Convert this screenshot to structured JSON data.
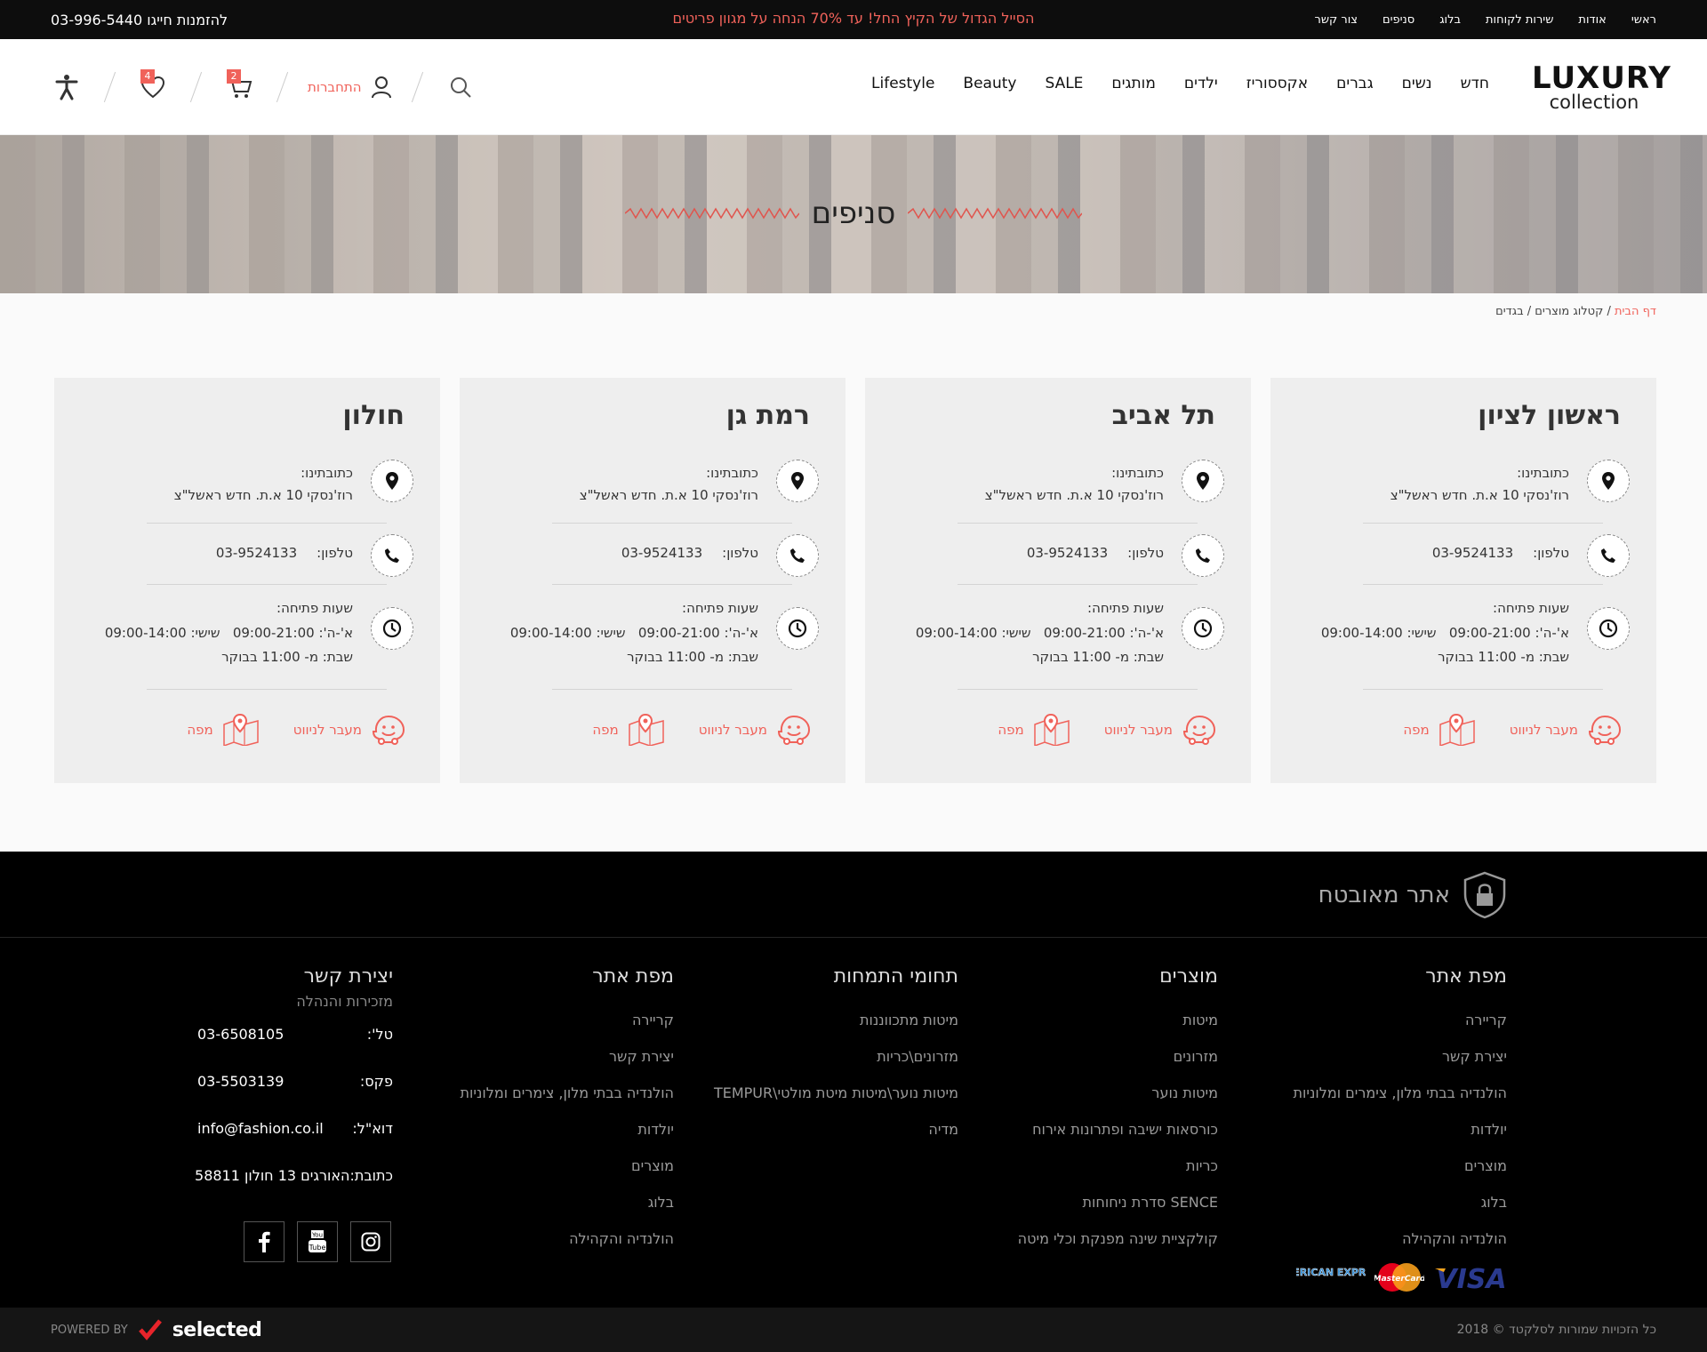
{
  "topbar": {
    "links": [
      "ראשי",
      "אודות",
      "שירות לקוחות",
      "בלוג",
      "סניפים",
      "צור קשר"
    ],
    "promo": "הסייל הגדול של הקיץ החל! עד 70% הנחה על מגוון פריטים",
    "phone_label": "להזמנות חייגו",
    "phone": "03-996-5440"
  },
  "header": {
    "logo_line1": "LUXURY",
    "logo_line2": "collection",
    "nav": [
      "חדש",
      "נשים",
      "גברים",
      "אקססוריז",
      "ילדים",
      "מותגים",
      "SALE",
      "Beauty",
      "Lifestyle"
    ],
    "login_label": "התחברות",
    "cart_count": "2",
    "wishlist_count": "4"
  },
  "hero": {
    "title": "סניפים"
  },
  "breadcrumb": {
    "home": "דף הבית",
    "sep1": " / ",
    "catalog": "קטלוג מוצרים",
    "sep2": " / ",
    "current": "בגדים"
  },
  "branches": [
    {
      "name": "ראשון לציון",
      "address_label": "כתובתינו:",
      "address": "רוז'נסקי 10 א.ת. חדש ראשל\"צ",
      "phone_label": "טלפון:",
      "phone": "03-9524133",
      "hours_label": "שעות פתיחה:",
      "hours1": "א'-ה': 09:00-21:00   שישי: 09:00-14:00",
      "hours2": "שבת: מ- 11:00 בבוקר",
      "nav_label": "מעבר לניווט",
      "map_label": "מפה"
    },
    {
      "name": "תל אביב",
      "address_label": "כתובתינו:",
      "address": "רוז'נסקי 10 א.ת. חדש ראשל\"צ",
      "phone_label": "טלפון:",
      "phone": "03-9524133",
      "hours_label": "שעות פתיחה:",
      "hours1": "א'-ה': 09:00-21:00   שישי: 09:00-14:00",
      "hours2": "שבת: מ- 11:00 בבוקר",
      "nav_label": "מעבר לניווט",
      "map_label": "מפה"
    },
    {
      "name": "רמת גן",
      "address_label": "כתובתינו:",
      "address": "רוז'נסקי 10 א.ת. חדש ראשל\"צ",
      "phone_label": "טלפון:",
      "phone": "03-9524133",
      "hours_label": "שעות פתיחה:",
      "hours1": "א'-ה': 09:00-21:00   שישי: 09:00-14:00",
      "hours2": "שבת: מ- 11:00 בבוקר",
      "nav_label": "מעבר לניווט",
      "map_label": "מפה"
    },
    {
      "name": "חולון",
      "address_label": "כתובתינו:",
      "address": "רוז'נסקי 10 א.ת. חדש ראשל\"צ",
      "phone_label": "טלפון:",
      "phone": "03-9524133",
      "hours_label": "שעות פתיחה:",
      "hours1": "א'-ה': 09:00-21:00   שישי: 09:00-14:00",
      "hours2": "שבת: מ- 11:00 בבוקר",
      "nav_label": "מעבר לניווט",
      "map_label": "מפה"
    }
  ],
  "footer": {
    "secure": "אתר מאובטח",
    "col1": {
      "title": "מפת אתר",
      "links": [
        "קריירה",
        "יצירת קשר",
        "הולנדיה בבתי מלון, צימרים ומלוניות",
        "יולדות",
        "מוצרים",
        "בלוג",
        "הולנדיה והקהילה"
      ]
    },
    "col2": {
      "title": "מוצרים",
      "links": [
        "מיטות",
        "מזרונים",
        "מיטות נוער",
        "כורסאות ישיבה ופתרונות אירוח",
        "כריות",
        "SENCE סדרת ניחוחות",
        "קולקציית שינה מפנקת וכלי מיטה"
      ]
    },
    "col3": {
      "title": "תחומי התמחות",
      "links": [
        "מיטות מתכווננות",
        "מזרונים\\כריות",
        "מיטות נוער\\מיטות מיטת מולטי\\TEMPUR",
        "מדיה"
      ]
    },
    "col4": {
      "title": "מפת אתר",
      "links": [
        "קריירה",
        "יצירת קשר",
        "הולנדיה בבתי מלון, צימרים ומלוניות",
        "יולדות",
        "מוצרים",
        "בלוג",
        "הולנדיה והקהילה"
      ]
    },
    "contact": {
      "title": "יצירת קשר",
      "subtitle": "מזכירות והנהלה",
      "tel_label": "טל':",
      "tel": "03-6508105",
      "fax_label": "פקס:",
      "fax": "03-5503139",
      "email_label": "דוא\"ל:",
      "email": "info@fashion.co.il",
      "address_label": "כתובת:",
      "address": "האורגים 13 חולון 58811"
    },
    "payments": [
      "AMERICAN EXPRESS",
      "MasterCard",
      "VISA"
    ],
    "copyright": "כל הזכויות שמורות לסלקטד © 2018",
    "powered_by": "POWERED BY",
    "powered_brand": "selected"
  },
  "colors": {
    "accent": "#f0625a",
    "dark": "#0d0d0d"
  }
}
